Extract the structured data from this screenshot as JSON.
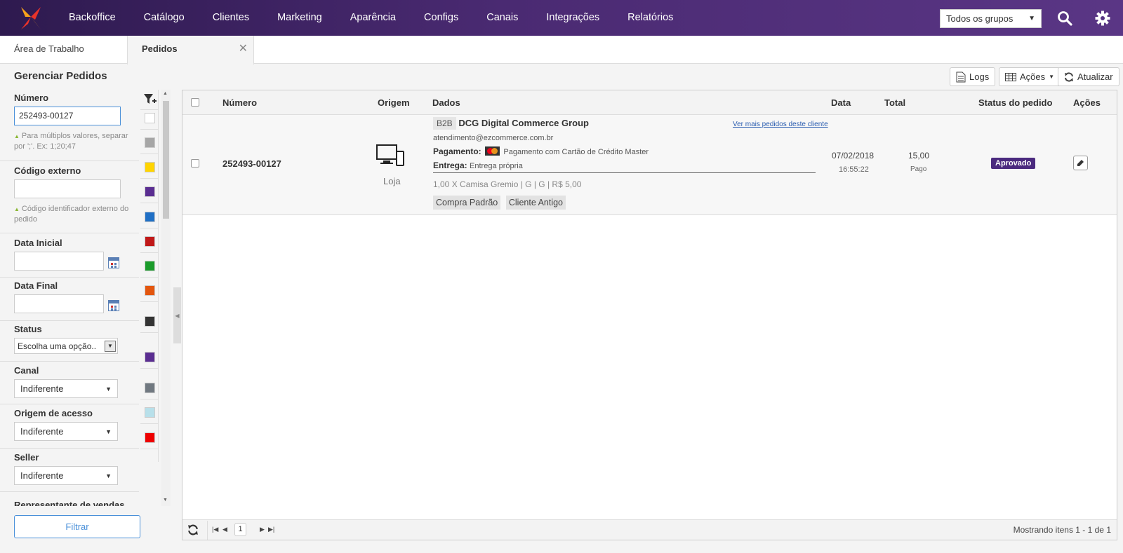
{
  "nav": {
    "items": [
      "Backoffice",
      "Catálogo",
      "Clientes",
      "Marketing",
      "Aparência",
      "Configs",
      "Canais",
      "Integrações",
      "Relatórios"
    ],
    "group_select": "Todos os grupos"
  },
  "tabs": [
    {
      "label": "Área de Trabalho"
    },
    {
      "label": "Pedidos"
    }
  ],
  "page": {
    "title": "Gerenciar Pedidos",
    "logs_label": "Logs",
    "actions_label": "Ações",
    "refresh_label": "Atualizar"
  },
  "filters": {
    "numero": {
      "label": "Número",
      "value": "252493-00127",
      "hint": "Para múltiplos valores, separar por ';'. Ex: 1;20;47"
    },
    "codigo_externo": {
      "label": "Código externo",
      "value": "",
      "hint": "Código identificador externo do pedido"
    },
    "data_inicial": {
      "label": "Data Inicial",
      "value": ""
    },
    "data_final": {
      "label": "Data Final",
      "value": ""
    },
    "status": {
      "label": "Status",
      "value": "Escolha uma opção.."
    },
    "canal": {
      "label": "Canal",
      "value": "Indiferente"
    },
    "origem_acesso": {
      "label": "Origem de acesso",
      "value": "Indiferente"
    },
    "seller": {
      "label": "Seller",
      "value": "Indiferente"
    },
    "representante": {
      "label": "Representante de vendas"
    },
    "filter_button": "Filtrar"
  },
  "colors": [
    "#ffffff",
    "#a6a6a6",
    "#ffd400",
    "#5a2d91",
    "#1f6fc5",
    "#c01818",
    "#1a9b2a",
    "#e3560e",
    "#333333",
    "#5a2d91",
    "#707880",
    "#b8e0ea",
    "#ee0000"
  ],
  "table": {
    "headers": {
      "numero": "Número",
      "origem": "Origem",
      "dados": "Dados",
      "data": "Data",
      "total": "Total",
      "status": "Status do pedido",
      "acoes": "Ações"
    },
    "rows": [
      {
        "numero": "252493-00127",
        "origem": "Loja",
        "b2b": "B2B",
        "cliente": "DCG Digital Commerce Group",
        "ver_mais": "Ver mais pedidos deste cliente",
        "email": "atendimento@ezcommerce.com.br",
        "pagamento_label": "Pagamento:",
        "pagamento": "Pagamento com Cartão de Crédito Master",
        "entrega_label": "Entrega:",
        "entrega": "Entrega própria",
        "item": "1,00 X Camisa Gremio | G | G | R$ 5,00",
        "tags": [
          "Compra Padrão",
          "Cliente Antigo"
        ],
        "data": "07/02/2018",
        "hora": "16:55:22",
        "total": "15,00",
        "pago": "Pago",
        "status": "Aprovado"
      }
    ]
  },
  "pager": {
    "current_page": "1",
    "summary": "Mostrando itens 1 - 1 de 1"
  }
}
